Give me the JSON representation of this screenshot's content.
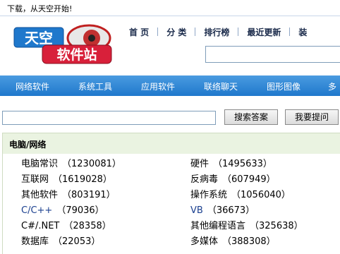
{
  "topbar": {
    "welcome": "下载，从天空开始!"
  },
  "logo": {
    "line1": "天空",
    "line2": "软件站"
  },
  "topnav": {
    "items": [
      "首 页",
      "分 类",
      "排行榜",
      "最近更新",
      "装"
    ]
  },
  "categories": [
    "网络软件",
    "系统工具",
    "应用软件",
    "联络聊天",
    "图形图像",
    "多"
  ],
  "search": {
    "ask_answer_label": "搜索答案",
    "ask_question_label": "我要提问",
    "value": ""
  },
  "panel": {
    "title": "电脑/网络",
    "items": [
      {
        "name": "电脑常识",
        "count": "（1230081）"
      },
      {
        "name": "硬件",
        "count": "（1495633）"
      },
      {
        "name": "互联网",
        "count": "（1619028）"
      },
      {
        "name": "反病毒",
        "count": "（607949）"
      },
      {
        "name": "其他软件",
        "count": "（803191）"
      },
      {
        "name": "操作系统",
        "count": "（1056040）"
      },
      {
        "name": "C/C++",
        "count": "（79036）"
      },
      {
        "name": "VB",
        "count": "（36673）"
      },
      {
        "name": "C#/.NET",
        "count": "（28358）"
      },
      {
        "name": "其他编程语言",
        "count": "（325638）"
      },
      {
        "name": "数据库",
        "count": "（22053）"
      },
      {
        "name": "多媒体",
        "count": "（388308）"
      }
    ]
  },
  "colors": {
    "nav_blue": "#1f78cc",
    "link_blue": "#1a3f8f",
    "panel_green": "#eaf3e1"
  }
}
